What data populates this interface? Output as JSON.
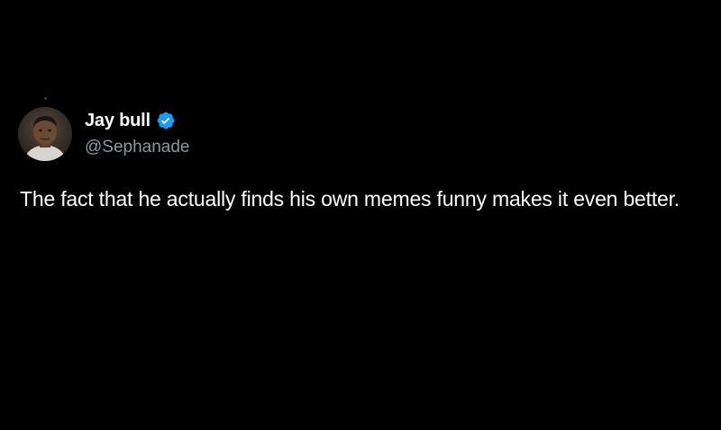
{
  "tweet": {
    "author": {
      "display_name": "Jay bull",
      "handle": "@Sephanade",
      "verified": true,
      "avatar_icon": "profile-photo"
    },
    "text": "The fact that he actually finds his own memes funny makes it even better."
  },
  "colors": {
    "background": "#000000",
    "text_primary": "#ffffff",
    "text_secondary": "#8b98a5",
    "verified_badge": "#1d9bf0"
  }
}
